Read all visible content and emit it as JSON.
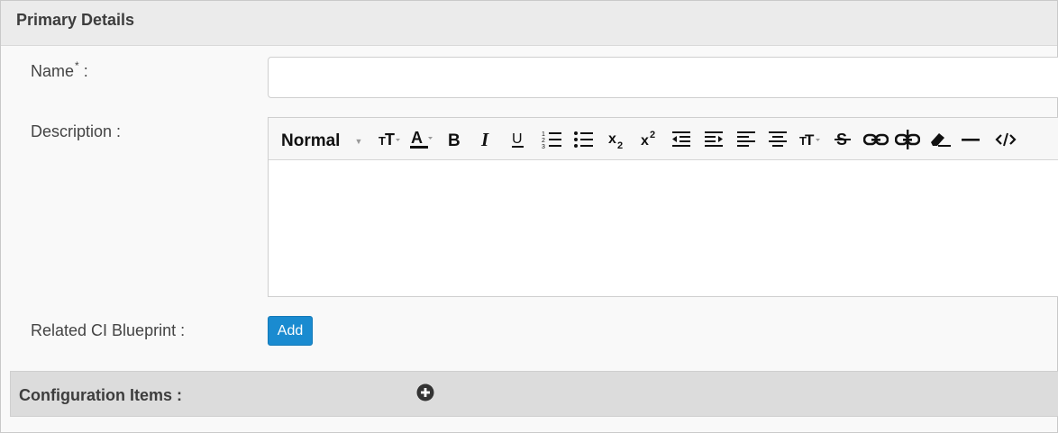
{
  "section": {
    "title": "Primary Details"
  },
  "fields": {
    "name": {
      "label": "Name",
      "required_mark": "*",
      "suffix": " :",
      "value": ""
    },
    "description": {
      "label": "Description :"
    },
    "related_ci": {
      "label": "Related CI Blueprint :",
      "button": "Add"
    }
  },
  "editor": {
    "format_label": "Normal",
    "tools": [
      "font-size",
      "font-color",
      "bold",
      "italic",
      "underline",
      "ordered-list",
      "unordered-list",
      "subscript",
      "superscript",
      "outdent",
      "indent",
      "align-left",
      "align-center",
      "text-height",
      "strikethrough",
      "link",
      "unlink",
      "clear-format",
      "horizontal-rule",
      "code-view"
    ],
    "content": ""
  },
  "config_items": {
    "title": "Configuration Items :"
  },
  "colors": {
    "accent": "#1a8bd0",
    "header_bg": "#ebebeb",
    "bar_bg": "#dcdcdc"
  }
}
